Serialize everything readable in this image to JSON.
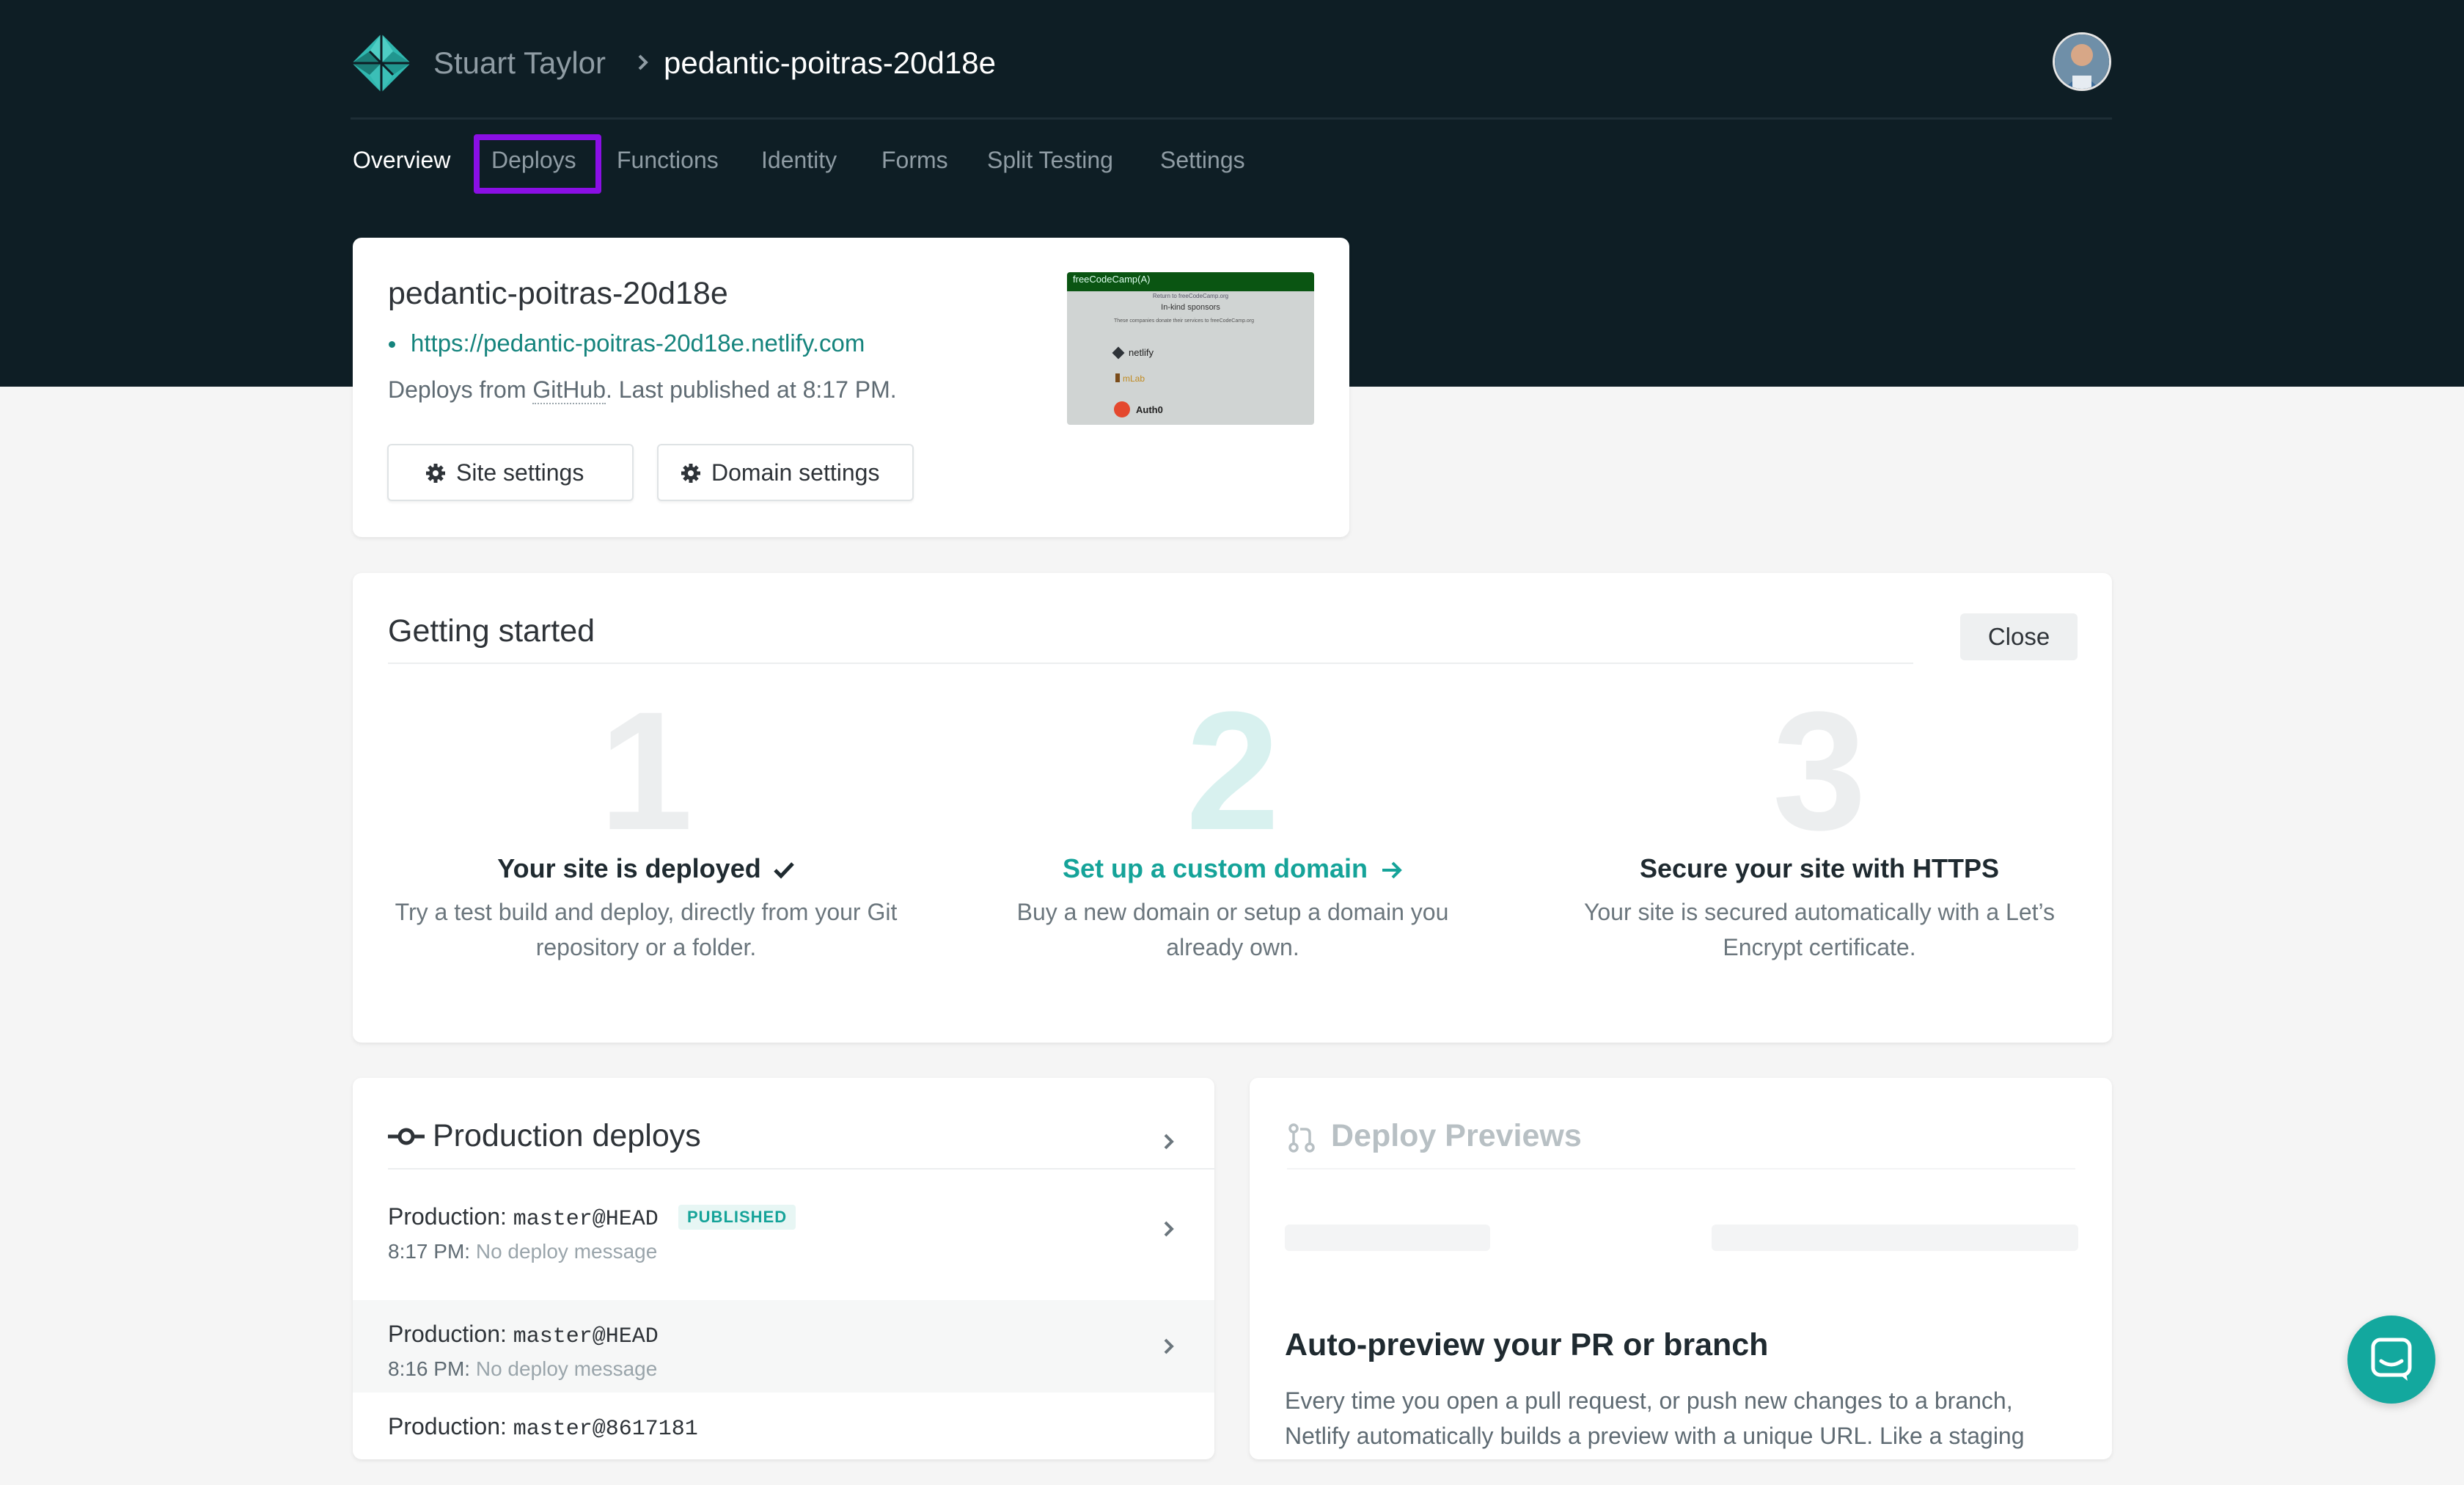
{
  "header": {
    "owner": "Stuart Taylor",
    "site": "pedantic-poitras-20d18e"
  },
  "nav": [
    {
      "label": "Overview",
      "active": true
    },
    {
      "label": "Deploys",
      "active": false,
      "highlighted": true
    },
    {
      "label": "Functions",
      "active": false
    },
    {
      "label": "Identity",
      "active": false
    },
    {
      "label": "Forms",
      "active": false
    },
    {
      "label": "Split Testing",
      "active": false
    },
    {
      "label": "Settings",
      "active": false
    }
  ],
  "site_card": {
    "name": "pedantic-poitras-20d18e",
    "url": "https://pedantic-poitras-20d18e.netlify.com",
    "meta_prefix": "Deploys from ",
    "meta_source": "GitHub",
    "meta_suffix": ". Last published at 8:17 PM.",
    "site_settings_label": "Site settings",
    "domain_settings_label": "Domain settings",
    "thumbnail": {
      "header": "freeCodeCamp(A)",
      "subheader": "Return to freeCodeCamp.org",
      "heading": "In-kind sponsors",
      "blurb": "These companies donate their services to freeCodeCamp.org",
      "sponsors": [
        "netlify",
        "mLab",
        "Auth0"
      ]
    }
  },
  "getting_started": {
    "title": "Getting started",
    "close_label": "Close",
    "steps": [
      {
        "num": "1",
        "title": "Your site is deployed",
        "desc": "Try a test build and deploy, directly from your Git repository or a folder."
      },
      {
        "num": "2",
        "title": "Set up a custom domain",
        "desc": "Buy a new domain or setup a domain you already own."
      },
      {
        "num": "3",
        "title": "Secure your site with HTTPS",
        "desc": "Your site is secured automatically with a Let’s Encrypt certificate."
      }
    ]
  },
  "production": {
    "title": "Production deploys",
    "rows": [
      {
        "prefix": "Production: ",
        "ref": "master@HEAD",
        "badge": "PUBLISHED",
        "time": "8:17 PM:",
        "message": "No deploy message"
      },
      {
        "prefix": "Production: ",
        "ref": "master@HEAD",
        "badge": "",
        "time": "8:16 PM:",
        "message": "No deploy message"
      },
      {
        "prefix": "Production: ",
        "ref": "master@8617181",
        "badge": "",
        "time": "",
        "message": ""
      }
    ]
  },
  "previews": {
    "title": "Deploy Previews",
    "heading": "Auto-preview your PR or branch",
    "body": "Every time you open a pull request, or push new changes to a branch, Netlify automatically builds a preview with a unique URL. Like a staging"
  },
  "colors": {
    "header_bg": "#0e1e25",
    "accent_teal": "#15a399",
    "highlight_purple": "#8a0fe5"
  }
}
